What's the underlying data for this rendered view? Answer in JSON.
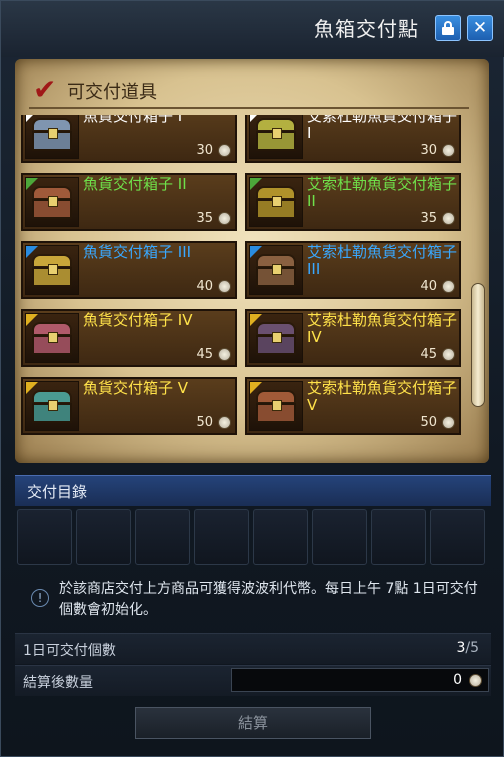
{
  "window": {
    "title": "魚箱交付點",
    "lock_icon": "lock-icon",
    "close_icon": "close-icon",
    "close_label": "✕"
  },
  "deliverable": {
    "title": "可交付道具",
    "check_icon": "checkmark-icon",
    "check_glyph": "✔",
    "items": [
      {
        "name": "魚貨交付箱子 I",
        "qty": "30",
        "grade": "#ffffff",
        "name_color": "#ffffff",
        "chest_color": "#7f95b0"
      },
      {
        "name": "艾索杜勒魚貨交付箱子 I",
        "qty": "30",
        "grade": "#ffffff",
        "name_color": "#ffffff",
        "chest_color": "#b3b040"
      },
      {
        "name": "魚貨交付箱子 II",
        "qty": "35",
        "grade": "#4ca83a",
        "name_color": "#6fe04a",
        "chest_color": "#a05a3a"
      },
      {
        "name": "艾索杜勒魚貨交付箱子 II",
        "qty": "35",
        "grade": "#4ca83a",
        "name_color": "#6fe04a",
        "chest_color": "#b0922a"
      },
      {
        "name": "魚貨交付箱子 III",
        "qty": "40",
        "grade": "#2a8ce0",
        "name_color": "#39a8ff",
        "chest_color": "#c8a63a"
      },
      {
        "name": "艾索杜勒魚貨交付箱子 III",
        "qty": "40",
        "grade": "#2a8ce0",
        "name_color": "#39a8ff",
        "chest_color": "#8a6040"
      },
      {
        "name": "魚貨交付箱子 IV",
        "qty": "45",
        "grade": "#e0b020",
        "name_color": "#ffe24a",
        "chest_color": "#b05a6a"
      },
      {
        "name": "艾索杜勒魚貨交付箱子 IV",
        "qty": "45",
        "grade": "#e0b020",
        "name_color": "#ffe24a",
        "chest_color": "#6a5070"
      },
      {
        "name": "魚貨交付箱子 V",
        "qty": "50",
        "grade": "#e0b020",
        "name_color": "#ffe24a",
        "chest_color": "#4a9a92"
      },
      {
        "name": "艾索杜勒魚貨交付箱子 V",
        "qty": "50",
        "grade": "#e0b020",
        "name_color": "#ffe24a",
        "chest_color": "#a05a38"
      }
    ]
  },
  "catalog": {
    "title": "交付目錄",
    "slot_count": 8
  },
  "notice": {
    "icon": "info-icon",
    "icon_glyph": "!",
    "text": "於該商店交付上方商品可獲得波波利代幣。每日上午 7點 1日可交付個數會初始化。"
  },
  "daily": {
    "label": "1日可交付個數",
    "current": "3",
    "max": "/5"
  },
  "result": {
    "label": "結算後數量",
    "value": "0",
    "coin_icon": "coin-icon"
  },
  "settle_button": "結算"
}
